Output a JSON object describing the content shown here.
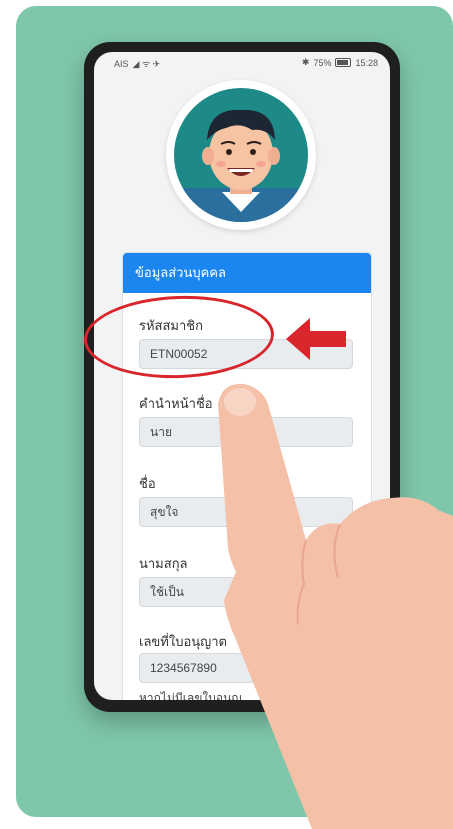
{
  "statusbar": {
    "carrier": "AIS",
    "left_icons": "◢ ᯤ ✈",
    "battery": "75%",
    "time": "15:28"
  },
  "card": {
    "header": "ข้อมูลส่วนบุคคล",
    "fields": [
      {
        "label": "รหัสสมาชิก",
        "value": "ETN00052"
      },
      {
        "label": "คำนำหน้าชื่อ",
        "value": "นาย"
      },
      {
        "label": "ชื่อ",
        "value": "สุขใจ"
      },
      {
        "label": "นามสกุล",
        "value": "ใช้เป็น"
      },
      {
        "label": "เลขที่ใบอนุญาต",
        "value": "1234567890"
      }
    ],
    "hint": "หากไม่มีเลขใบอนุญ"
  },
  "colors": {
    "backdrop": "#7fc7aa",
    "header": "#1b86f0",
    "annotation": "#d8262c",
    "skin": "#f4c0a8"
  },
  "icons": [
    "user-avatar-icon",
    "red-arrow-icon",
    "pointing-hand-icon",
    "battery-icon",
    "signal-icon",
    "wifi-icon"
  ]
}
